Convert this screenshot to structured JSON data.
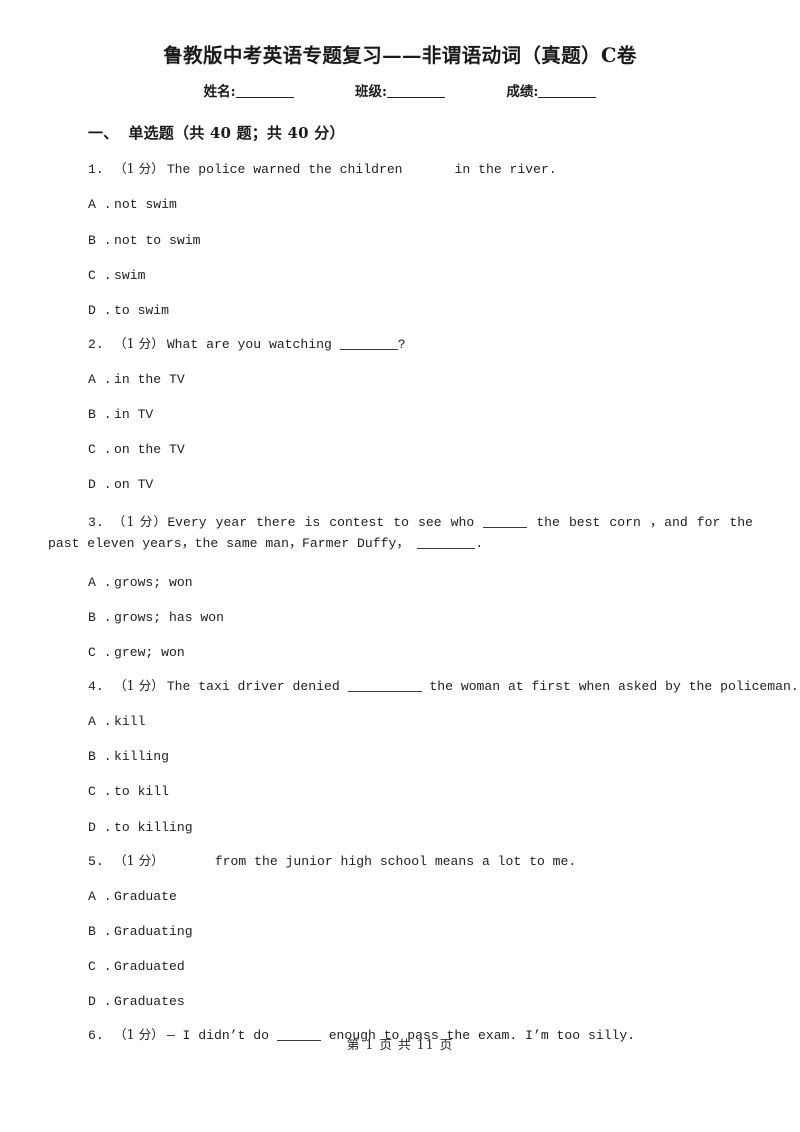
{
  "document": {
    "title": "鲁教版中考英语专题复习——非谓语动词（真题）C卷",
    "fields": {
      "name_label": "姓名:",
      "class_label": "班级:",
      "score_label": "成绩:"
    },
    "footer": "第 1 页 共 11 页"
  },
  "section": {
    "number": "一、",
    "title": "单选题（共 40 题；共 40 分）"
  },
  "questions": [
    {
      "number": "1.",
      "points": "（1 分）",
      "text_before": "The police warned the children",
      "blank": "space",
      "text_after": "in the river.",
      "options": [
        {
          "key": "A .",
          "text": "not swim"
        },
        {
          "key": "B .",
          "text": "not to swim"
        },
        {
          "key": "C .",
          "text": "swim"
        },
        {
          "key": "D .",
          "text": "to swim"
        }
      ]
    },
    {
      "number": "2.",
      "points": "（1 分）",
      "text_before": "What are you watching",
      "blank": "underline",
      "text_after": "?",
      "options": [
        {
          "key": "A .",
          "text": "in the TV"
        },
        {
          "key": "B .",
          "text": "in TV"
        },
        {
          "key": "C .",
          "text": "on the TV"
        },
        {
          "key": "D .",
          "text": "on TV"
        }
      ]
    },
    {
      "number": "3.",
      "points": "（1 分）",
      "text_part1": "Every year there is contest to see who",
      "text_part2": "the best corn ，and for the past eleven years，the same man，Farmer Duffy，",
      "text_part3": ".",
      "options": [
        {
          "key": "A .",
          "text": "grows; won"
        },
        {
          "key": "B .",
          "text": "grows; has won"
        },
        {
          "key": "C .",
          "text": "grew; won"
        }
      ]
    },
    {
      "number": "4.",
      "points": "（1 分）",
      "text_before": "The taxi driver denied",
      "blank": "underline",
      "text_after": "the woman at first when asked by the policeman.",
      "options": [
        {
          "key": "A .",
          "text": "kill"
        },
        {
          "key": "B .",
          "text": "killing"
        },
        {
          "key": "C .",
          "text": "to kill"
        },
        {
          "key": "D .",
          "text": "to killing"
        }
      ]
    },
    {
      "number": "5.",
      "points": "（1 分）",
      "text_before": "",
      "blank": "space",
      "text_after": "from the junior high school means a lot to me.",
      "options": [
        {
          "key": "A .",
          "text": "Graduate"
        },
        {
          "key": "B .",
          "text": "Graduating"
        },
        {
          "key": "C .",
          "text": "Graduated"
        },
        {
          "key": "D .",
          "text": "Graduates"
        }
      ]
    },
    {
      "number": "6.",
      "points": "（1 分）",
      "text_before": "— I didn’t do",
      "blank": "underline",
      "text_after": "enough to pass the exam. I’m too silly.",
      "options": []
    }
  ]
}
